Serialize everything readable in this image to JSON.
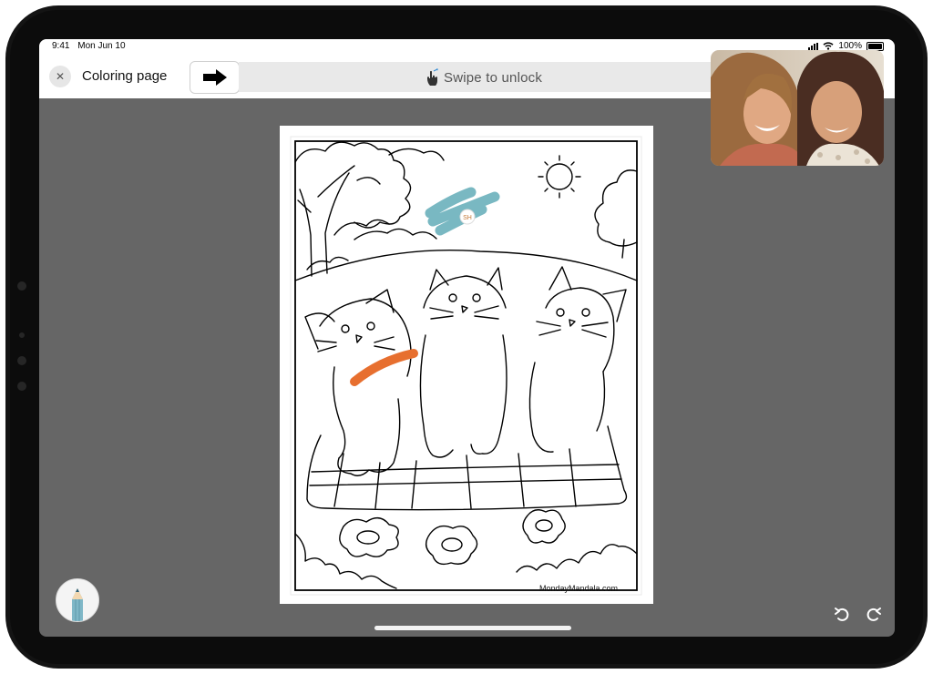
{
  "status_bar": {
    "time": "9:41",
    "date": "Mon Jun 10",
    "battery": "100%"
  },
  "header": {
    "close_label": "✕",
    "title": "Coloring page"
  },
  "swipe": {
    "label": "Swipe to unlock"
  },
  "coloring_page": {
    "watermark": "MondayMandala.com",
    "collaborator_initials": "SH"
  },
  "colors": {
    "teal_stroke": "#79b8c2",
    "orange_stroke": "#e76f2f",
    "canvas_bg": "#666666"
  },
  "icons": [
    "close-icon",
    "arrow-right-icon",
    "tap-hand-icon",
    "pencil-icon",
    "undo-icon",
    "redo-icon"
  ]
}
